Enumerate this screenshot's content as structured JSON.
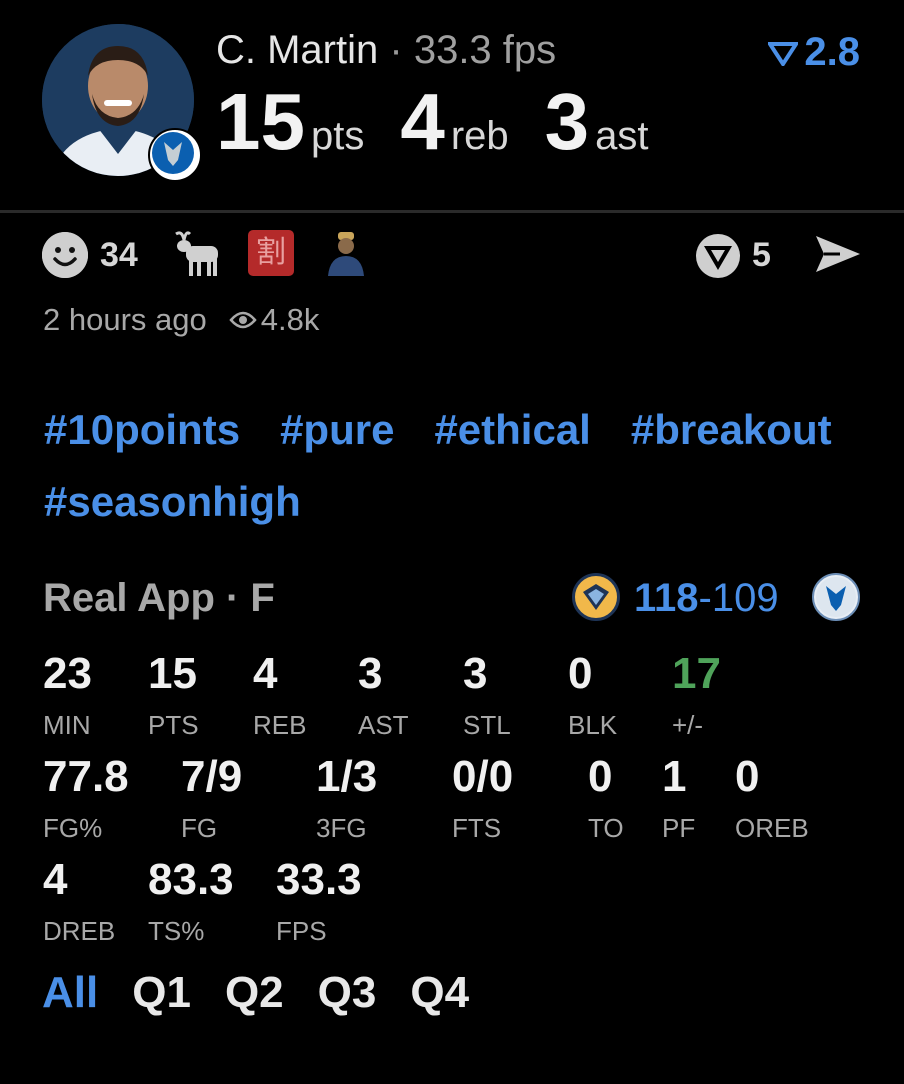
{
  "header": {
    "player_name": "C. Martin",
    "separator": "·",
    "fps_label": "33.3 fps",
    "rating": "2.8",
    "pts": "15",
    "pts_unit": "pts",
    "reb": "4",
    "reb_unit": "reb",
    "ast": "3",
    "ast_unit": "ast"
  },
  "reactions": {
    "smile_count": "34",
    "stamp_char": "割",
    "vote_count": "5",
    "time_ago": "2 hours ago",
    "views": "4.8k"
  },
  "tags": [
    "#10points",
    "#pure",
    "#ethical",
    "#breakout",
    "#seasonhigh"
  ],
  "game": {
    "title": "Real App · F",
    "score_high": "118",
    "score_dash": "-",
    "score_low": "109"
  },
  "stats": [
    {
      "value": "23",
      "label": "MIN"
    },
    {
      "value": "15",
      "label": "PTS"
    },
    {
      "value": "4",
      "label": "REB"
    },
    {
      "value": "3",
      "label": "AST"
    },
    {
      "value": "3",
      "label": "STL"
    },
    {
      "value": "0",
      "label": "BLK"
    },
    {
      "value": "17",
      "label": "+/-"
    },
    {
      "value": "77.8",
      "label": "FG%"
    },
    {
      "value": "7/9",
      "label": "FG"
    },
    {
      "value": "1/3",
      "label": "3FG"
    },
    {
      "value": "0/0",
      "label": "FTS"
    },
    {
      "value": "0",
      "label": "TO"
    },
    {
      "value": "1",
      "label": "PF"
    },
    {
      "value": "0",
      "label": "OREB"
    },
    {
      "value": "4",
      "label": "DREB"
    },
    {
      "value": "83.3",
      "label": "TS%"
    },
    {
      "value": "33.3",
      "label": "FPS"
    }
  ],
  "quarter_tabs": [
    "All",
    "Q1",
    "Q2",
    "Q3",
    "Q4"
  ],
  "colors": {
    "accent": "#4a8fe7",
    "positive": "#4fa35a",
    "background": "#000000"
  },
  "icons": [
    "smile-icon",
    "goat-icon",
    "vote-icon",
    "send-icon",
    "eye-icon",
    "rating-chevron-icon"
  ]
}
